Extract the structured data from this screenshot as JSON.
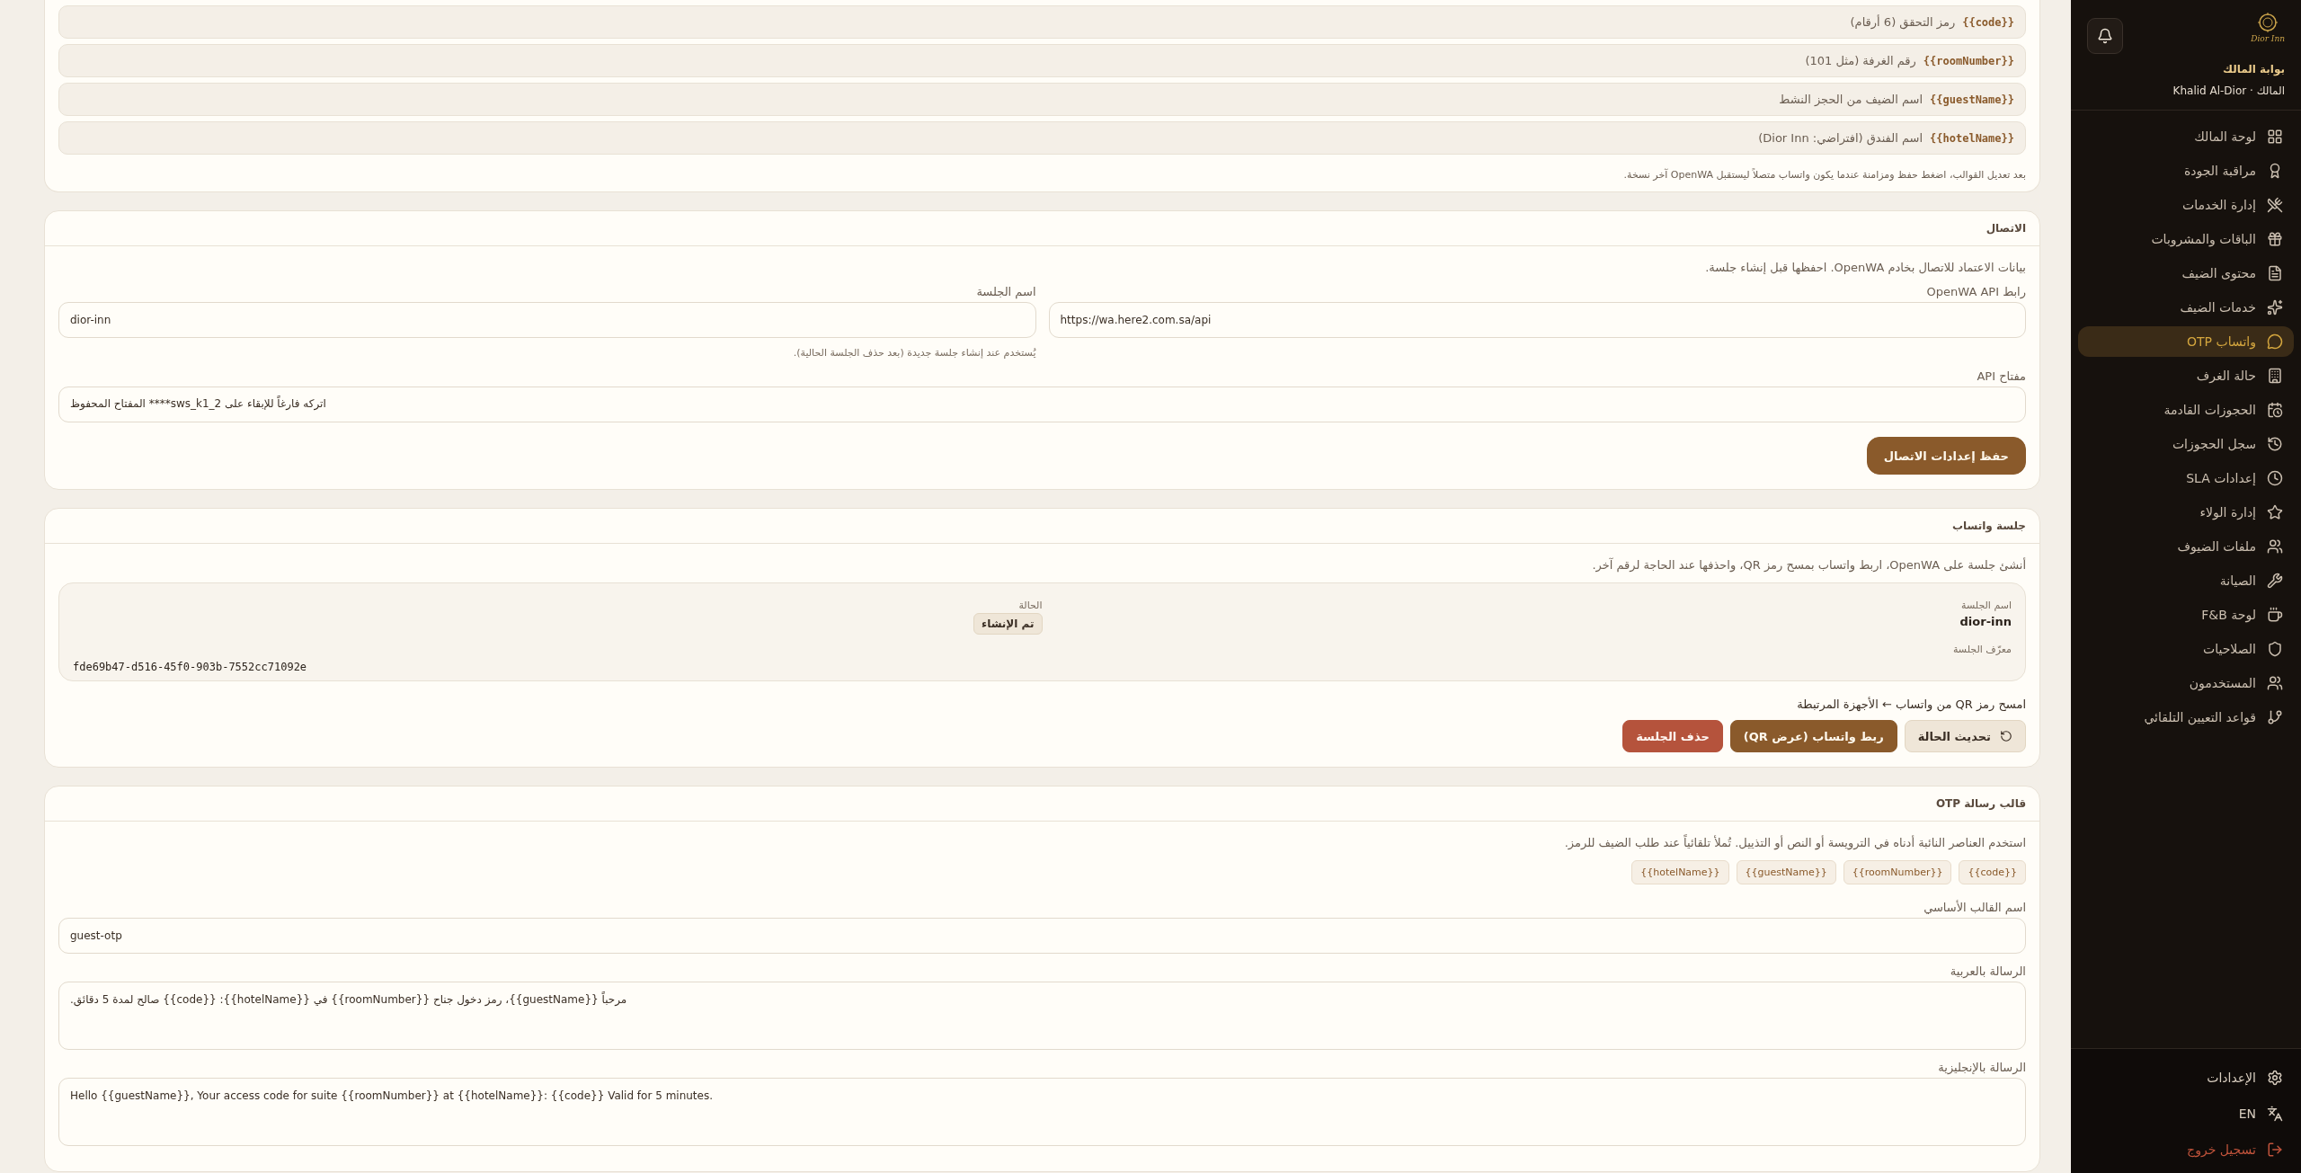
{
  "sidebar": {
    "logo_text": "Dior Inn",
    "brand_title": "بوابة المالك",
    "user": "المالك · Khalid Al-Dior",
    "nav": [
      {
        "label": "لوحة المالك",
        "selected": false
      },
      {
        "label": "مراقبة الجودة",
        "selected": false
      },
      {
        "label": "إدارة الخدمات",
        "selected": false
      },
      {
        "label": "الباقات والمشروبات",
        "selected": false
      },
      {
        "label": "محتوى الضيف",
        "selected": false
      },
      {
        "label": "خدمات الضيف",
        "selected": false
      },
      {
        "label": "واتساب OTP",
        "selected": true
      },
      {
        "label": "حالة الغرف",
        "selected": false
      },
      {
        "label": "الحجوزات القادمة",
        "selected": false
      },
      {
        "label": "سجل الحجوزات",
        "selected": false
      },
      {
        "label": "إعدادات SLA",
        "selected": false
      },
      {
        "label": "إدارة الولاء",
        "selected": false
      },
      {
        "label": "ملفات الضيوف",
        "selected": false
      },
      {
        "label": "الصيانة",
        "selected": false
      },
      {
        "label": "لوحة F&B",
        "selected": false
      },
      {
        "label": "الصلاحيات",
        "selected": false
      },
      {
        "label": "المستخدمون",
        "selected": false
      },
      {
        "label": "قواعد التعيين التلقائي",
        "selected": false
      }
    ],
    "footer": [
      {
        "kind": "settings",
        "label": "الإعدادات"
      },
      {
        "kind": "language",
        "label": "EN"
      },
      {
        "kind": "logout",
        "label": "تسجيل خروج"
      }
    ]
  },
  "placeholders_card": {
    "rows": [
      {
        "token": "{{code}}",
        "description": "رمز التحقق (6 أرقام)"
      },
      {
        "token": "{{roomNumber}}",
        "description": "رقم الغرفة (مثل 101)"
      },
      {
        "token": "{{guestName}}",
        "description": "اسم الضيف من الحجز النشط"
      },
      {
        "token": "{{hotelName}}",
        "description": "اسم الفندق (افتراضي: Dior Inn)"
      }
    ],
    "note": "بعد تعديل القوالب، اضغط حفظ ومزامنة عندما يكون واتساب متصلاً ليستقبل OpenWA آخر نسخة."
  },
  "connection_card": {
    "title": "الاتصال",
    "description": "بيانات الاعتماد للاتصال بخادم OpenWA. احفظها قبل إنشاء جلسة.",
    "api_url": {
      "label": "رابط OpenWA API",
      "value": "https://wa.here2.com.sa/api"
    },
    "session_name": {
      "label": "اسم الجلسة",
      "value": "dior-inn",
      "hint": "يُستخدم عند إنشاء جلسة جديدة (بعد حذف الجلسة الحالية)."
    },
    "api_key": {
      "label": "مفتاح API",
      "value": "اتركه فارغاً للإبقاء على sws_k1_2**** المفتاح المحفوظ"
    },
    "save_button": "حفظ إعدادات الاتصال"
  },
  "session_card": {
    "title": "جلسة واتساب",
    "description": "أنشئ جلسة على OpenWA، اربط واتساب بمسح رمز QR، واحذفها عند الحاجة لرقم آخر.",
    "name_label": "اسم الجلسة",
    "name_value": "dior-inn",
    "status_label": "الحالة",
    "status_badge": "تم الإنشاء",
    "id_label": "معرّف الجلسة",
    "id_value": "fde69b47-d516-45f0-903b-7552cc71092e",
    "qr_hint": "امسح رمز QR من واتساب ← الأجهزة المرتبطة",
    "buttons": [
      {
        "kind": "secondary",
        "label": "تحديث الحالة"
      },
      {
        "kind": "primary",
        "label": "ربط واتساب (عرض QR)"
      },
      {
        "kind": "danger",
        "label": "حذف الجلسة"
      }
    ]
  },
  "otp_card": {
    "title": "قالب رسالة OTP",
    "description": "استخدم العناصر النائبة أدناه في الترويسة أو النص أو التذييل. تُملأ تلقائياً عند طلب الضيف للرمز.",
    "chips": [
      "{{code}}",
      "{{roomNumber}}",
      "{{guestName}}",
      "{{hotelName}}"
    ],
    "template_name": {
      "label": "اسم القالب الأساسي",
      "value": "guest-otp"
    },
    "message_ar": {
      "label": "الرسالة بالعربية",
      "value": "مرحباً {{guestName}}، رمز دخول جناح {{roomNumber}} في {{hotelName}}: {{code}} صالح لمدة 5 دقائق."
    },
    "message_en": {
      "label": "الرسالة بالإنجليزية",
      "value": "Hello {{guestName}}, Your access code for suite {{roomNumber}} at {{hotelName}}: {{code}} Valid for 5 minutes."
    }
  }
}
